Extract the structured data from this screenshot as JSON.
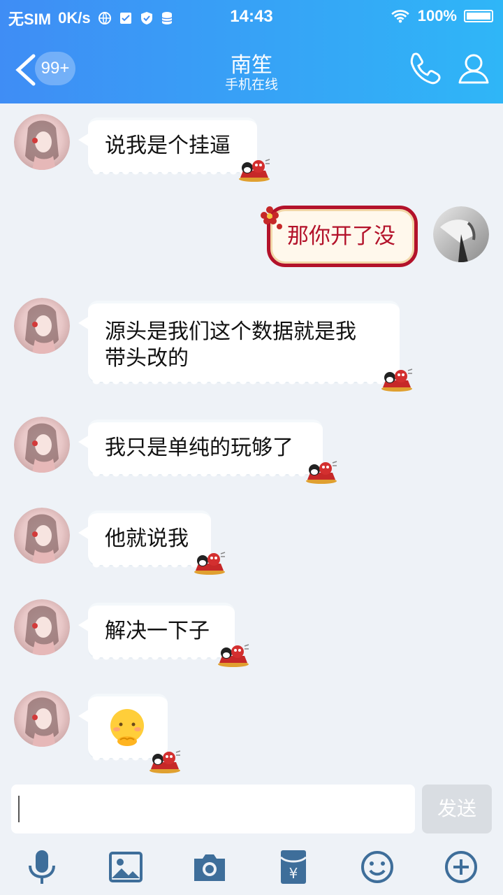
{
  "status_bar": {
    "carrier": "无SIM",
    "speed": "0K/s",
    "time": "14:43",
    "battery": "100%"
  },
  "header": {
    "back_badge": "99+",
    "title": "南笙",
    "subtitle": "手机在线",
    "accent_start": "#3f8df5",
    "accent_end": "#2fb6f7"
  },
  "messages": [
    {
      "side": "left",
      "text": "说我是个挂逼"
    },
    {
      "side": "right",
      "text": "那你开了没"
    },
    {
      "side": "left",
      "line1": "源头是我们这个数据就是我",
      "line2": "带头改的"
    },
    {
      "side": "left",
      "text": "我只是单纯的玩够了"
    },
    {
      "side": "left",
      "text": "他就说我"
    },
    {
      "side": "left",
      "text": "解决一下子"
    },
    {
      "side": "left",
      "emoji": "😌"
    }
  ],
  "input": {
    "value": "",
    "send_label": "发送"
  },
  "toolbar": [
    "mic-icon",
    "image-icon",
    "camera-icon",
    "red-packet-icon",
    "emoji-icon",
    "plus-icon"
  ]
}
